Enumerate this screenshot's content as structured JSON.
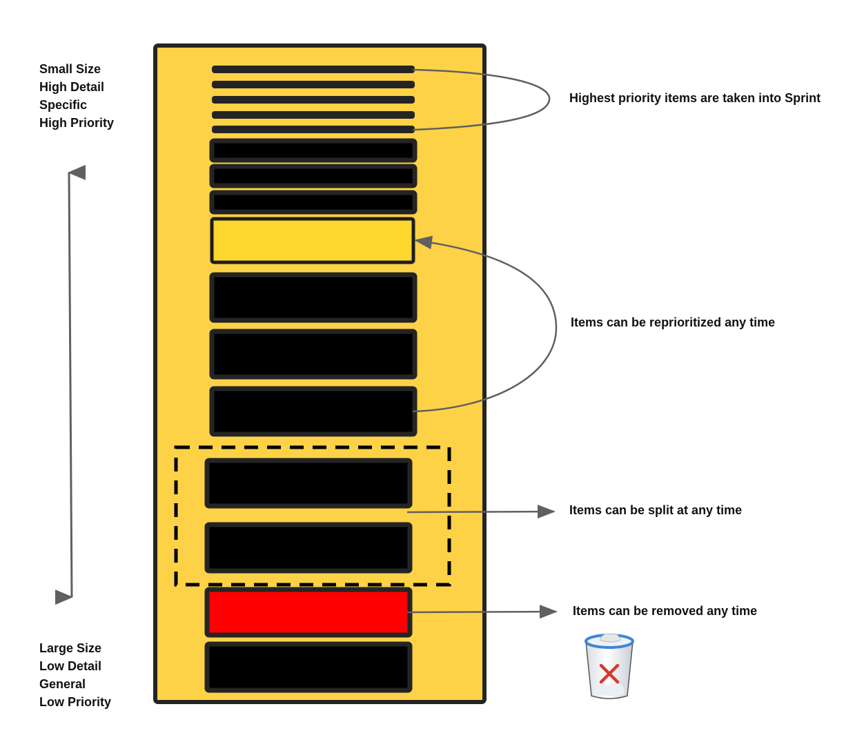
{
  "colors": {
    "backlog_fill": "#FDD247",
    "item_border": "#242424",
    "item_fill": "#000000",
    "highlight_item_fill": "#FDD72E",
    "removed_item_fill": "#FF0000",
    "connector": "#606060"
  },
  "top_axis_label": [
    "Small Size",
    "High Detail",
    "Specific",
    "High Priority"
  ],
  "bottom_axis_label": [
    "Large Size",
    "Low Detail",
    "General",
    "Low Priority"
  ],
  "annotations": {
    "sprint": "Highest priority items are taken into Sprint",
    "reprioritize": "Items can be reprioritized any time",
    "split": "Items can be split at any time",
    "remove": "Items can be removed any time"
  },
  "backlog_items": [
    {
      "size": "small",
      "state": "sprint"
    },
    {
      "size": "small",
      "state": "sprint"
    },
    {
      "size": "small",
      "state": "sprint"
    },
    {
      "size": "small",
      "state": "sprint"
    },
    {
      "size": "small",
      "state": "sprint"
    },
    {
      "size": "medium",
      "state": "normal"
    },
    {
      "size": "medium",
      "state": "normal"
    },
    {
      "size": "medium",
      "state": "normal"
    },
    {
      "size": "large",
      "state": "reprioritized"
    },
    {
      "size": "large",
      "state": "normal"
    },
    {
      "size": "large",
      "state": "normal"
    },
    {
      "size": "large",
      "state": "normal"
    },
    {
      "size": "large",
      "state": "split"
    },
    {
      "size": "large",
      "state": "split"
    },
    {
      "size": "large",
      "state": "removed"
    },
    {
      "size": "large",
      "state": "normal"
    }
  ],
  "icons": {
    "trash": "trash-can-icon",
    "remove_mark": "red-x-icon"
  }
}
